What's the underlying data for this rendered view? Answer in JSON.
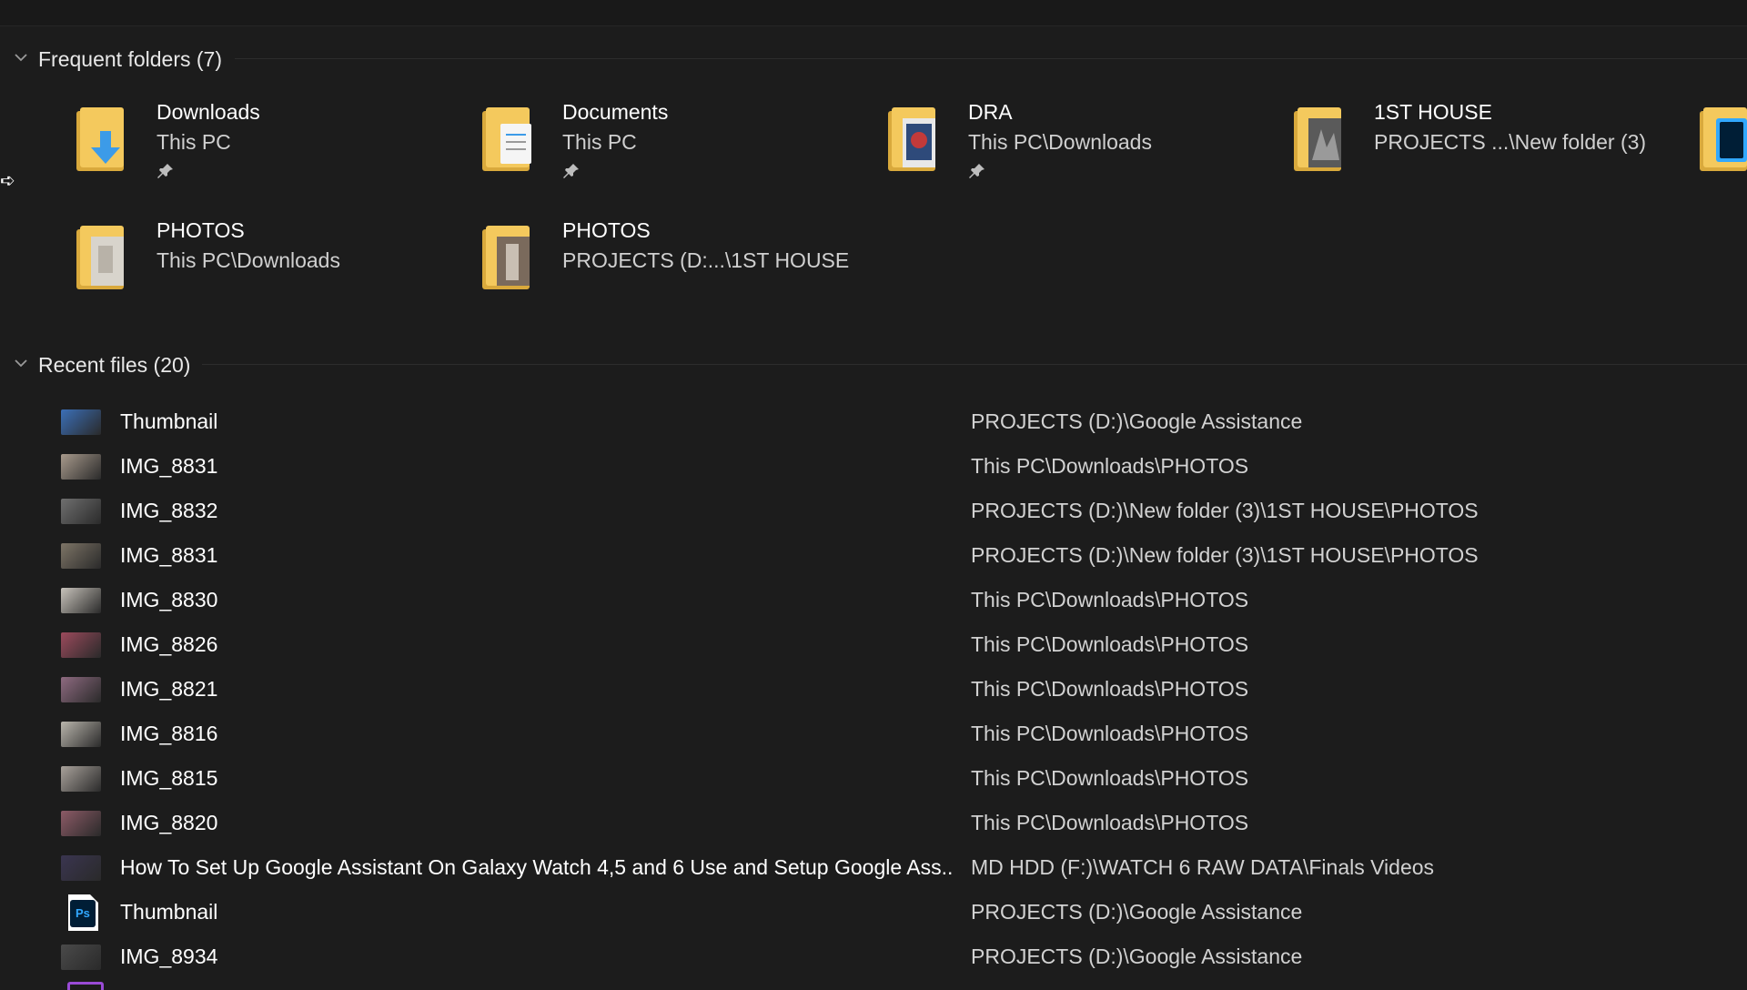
{
  "frequent": {
    "title": "Frequent folders (7)",
    "folders": [
      {
        "name": "Downloads",
        "path": "This PC",
        "pinned": true,
        "icon": "downloads-folder-icon"
      },
      {
        "name": "Documents",
        "path": "This PC",
        "pinned": true,
        "icon": "documents-folder-icon"
      },
      {
        "name": "DRA",
        "path": "This PC\\Downloads",
        "pinned": true,
        "icon": "folder-icon"
      },
      {
        "name": "1ST HOUSE",
        "path": "PROJECTS ...\\New folder (3)",
        "pinned": false,
        "icon": "folder-icon"
      },
      {
        "name": "PHOTOS",
        "path": "This PC\\Downloads",
        "pinned": false,
        "icon": "folder-icon"
      },
      {
        "name": "PHOTOS",
        "path": "PROJECTS (D:...\\1ST HOUSE",
        "pinned": false,
        "icon": "folder-icon"
      }
    ]
  },
  "recent": {
    "title": "Recent files (20)",
    "files": [
      {
        "name": "Thumbnail",
        "location": "PROJECTS (D:)\\Google Assistance",
        "thumb_color": "#3b6fb8"
      },
      {
        "name": "IMG_8831",
        "location": "This PC\\Downloads\\PHOTOS",
        "thumb_color": "#a89a8c"
      },
      {
        "name": "IMG_8832",
        "location": "PROJECTS (D:)\\New folder (3)\\1ST HOUSE\\PHOTOS",
        "thumb_color": "#6f6f6f"
      },
      {
        "name": "IMG_8831",
        "location": "PROJECTS (D:)\\New folder (3)\\1ST HOUSE\\PHOTOS",
        "thumb_color": "#7d7466"
      },
      {
        "name": "IMG_8830",
        "location": "This PC\\Downloads\\PHOTOS",
        "thumb_color": "#c8c3bb"
      },
      {
        "name": "IMG_8826",
        "location": "This PC\\Downloads\\PHOTOS",
        "thumb_color": "#9b4a5c"
      },
      {
        "name": "IMG_8821",
        "location": "This PC\\Downloads\\PHOTOS",
        "thumb_color": "#8e6a80"
      },
      {
        "name": "IMG_8816",
        "location": "This PC\\Downloads\\PHOTOS",
        "thumb_color": "#b9b5ac"
      },
      {
        "name": "IMG_8815",
        "location": "This PC\\Downloads\\PHOTOS",
        "thumb_color": "#a9a29b"
      },
      {
        "name": "IMG_8820",
        "location": "This PC\\Downloads\\PHOTOS",
        "thumb_color": "#8c5a66"
      },
      {
        "name": "How To Set Up Google Assistant On Galaxy Watch 4,5 and 6 Use and Setup Google Ass...",
        "location": "MD HDD (F:)\\WATCH 6 RAW DATA\\Finals Videos",
        "thumb_color": "#3a3550"
      },
      {
        "name": "Thumbnail",
        "location": "PROJECTS (D:)\\Google Assistance",
        "thumb_color": "#ps"
      },
      {
        "name": "IMG_8934",
        "location": "PROJECTS (D:)\\Google Assistance",
        "thumb_color": "#4a4a4a"
      }
    ]
  },
  "colors": {
    "background": "#1c1c1c",
    "folder_yellow": "#f4c95d",
    "ps_blue": "#31a8ff"
  }
}
